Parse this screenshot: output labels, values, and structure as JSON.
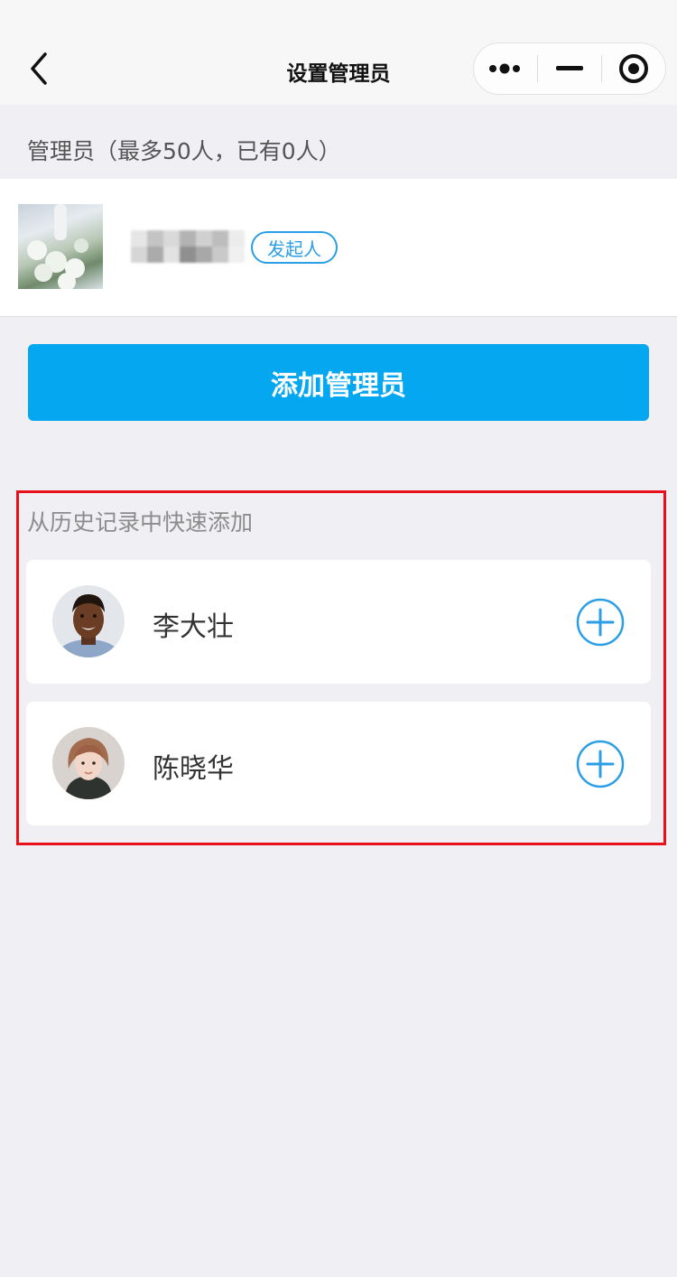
{
  "navbar": {
    "title": "设置管理员",
    "icons": {
      "back": "chevron-left-icon",
      "more": "more-dots-icon",
      "minimize": "minus-icon",
      "close": "target-circle-icon"
    }
  },
  "admins": {
    "header": "管理员（最多50人，已有0人）",
    "initiator": {
      "tag": "发起人",
      "avatar": "bouquet-photo-avatar",
      "name_blurred": true
    }
  },
  "add_button": {
    "label": "添加管理员"
  },
  "history": {
    "title": "从历史记录中快速添加",
    "people": [
      {
        "name": "李大壮",
        "avatar": "man-portrait-avatar",
        "action_icon": "plus-circle-icon"
      },
      {
        "name": "陈晓华",
        "avatar": "woman-portrait-avatar",
        "action_icon": "plus-circle-icon"
      }
    ],
    "highlight_color": "#e8101b"
  },
  "colors": {
    "accent": "#05a7f1",
    "tag": "#2a9fe6",
    "background": "#efeff4"
  }
}
